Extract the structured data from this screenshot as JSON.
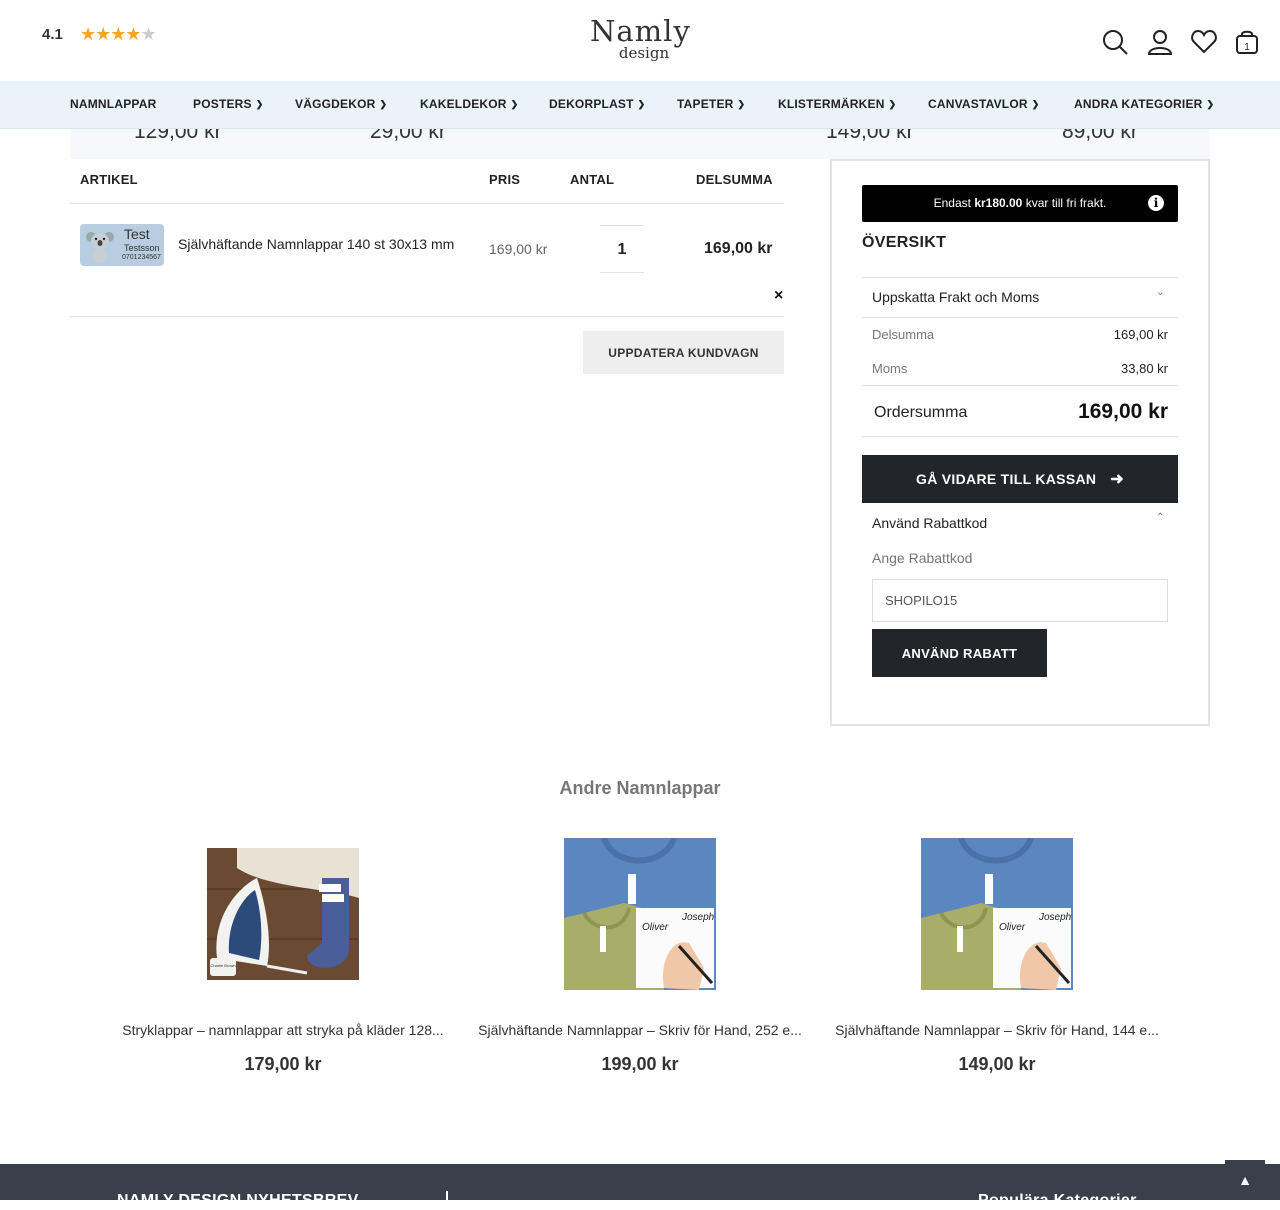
{
  "header": {
    "rating": "4.1",
    "stars_value": 4.1,
    "stars_max": 5,
    "logo_line1": "Namly",
    "logo_line2": "design",
    "cart_count": "1",
    "icons": [
      "search-icon",
      "user-icon",
      "heart-icon",
      "cart-icon"
    ]
  },
  "nav": {
    "items": [
      {
        "label": "NAMNLAPPAR",
        "has_dropdown": false
      },
      {
        "label": "POSTERS",
        "has_dropdown": true
      },
      {
        "label": "VÄGGDEKOR",
        "has_dropdown": true
      },
      {
        "label": "KAKELDEKOR",
        "has_dropdown": true
      },
      {
        "label": "DEKORPLAST",
        "has_dropdown": true
      },
      {
        "label": "TAPETER",
        "has_dropdown": true
      },
      {
        "label": "KLISTERMÄRKEN",
        "has_dropdown": true
      },
      {
        "label": "CANVASTAVLOR",
        "has_dropdown": true
      },
      {
        "label": "ANDRA KATEGORIER",
        "has_dropdown": true
      }
    ]
  },
  "upsell_prices": [
    "129,00 kr",
    "29,00 kr",
    "149,00 kr",
    "89,00 kr"
  ],
  "cart": {
    "columns": {
      "item": "ARTIKEL",
      "price": "PRIS",
      "qty": "ANTAL",
      "subtotal": "DELSUMMA"
    },
    "items": [
      {
        "thumb_text1": "Test",
        "thumb_text2": "Testsson",
        "thumb_text3": "0701234567",
        "name": "Självhäftande Namnlappar 140 st 30x13 mm",
        "price": "169,00 kr",
        "qty": "1",
        "subtotal": "169,00 kr"
      }
    ],
    "remove_label": "×",
    "update_button": "UPPDATERA KUNDVAGN"
  },
  "summary": {
    "free_shipping_prefix": "Endast ",
    "free_shipping_amount": "kr180.00",
    "free_shipping_suffix": " kvar till fri frakt.",
    "title": "ÖVERSIKT",
    "estimate_label": "Uppskatta Frakt och Moms",
    "subtotal_label": "Delsumma",
    "subtotal_value": "169,00 kr",
    "tax_label": "Moms",
    "tax_value": "33,80 kr",
    "total_label": "Ordersumma",
    "total_value": "169,00 kr",
    "checkout_button": "GÅ VIDARE TILL KASSAN",
    "discount_label": "Använd Rabattkod",
    "coupon_field_label": "Ange Rabattkod",
    "coupon_value": "SHOPILO15",
    "apply_button": "ANVÄND RABATT"
  },
  "related": {
    "title": "Andre Namnlappar",
    "products": [
      {
        "name": "Stryklappar – namnlappar att stryka på kläder 128...",
        "price": "179,00 kr",
        "thumb_label": "Charlie Brown"
      },
      {
        "name": "Självhäftande Namnlappar – Skriv för Hand, 252 e...",
        "price": "199,00 kr",
        "thumb_label1": "Oliver",
        "thumb_label2": "Joseph"
      },
      {
        "name": "Självhäftande Namnlappar – Skriv för Hand, 144 e...",
        "price": "149,00 kr",
        "thumb_label1": "Oliver",
        "thumb_label2": "Joseph"
      }
    ]
  },
  "footer": {
    "heading_left": "NAMLY DESIGN NYHETSBREV",
    "heading_right": "Populära Kategorier"
  },
  "colors": {
    "accent": "#222529",
    "nav_bg": "#eaf2fa",
    "star": "#f5a623",
    "footer": "#3a3f4b"
  }
}
